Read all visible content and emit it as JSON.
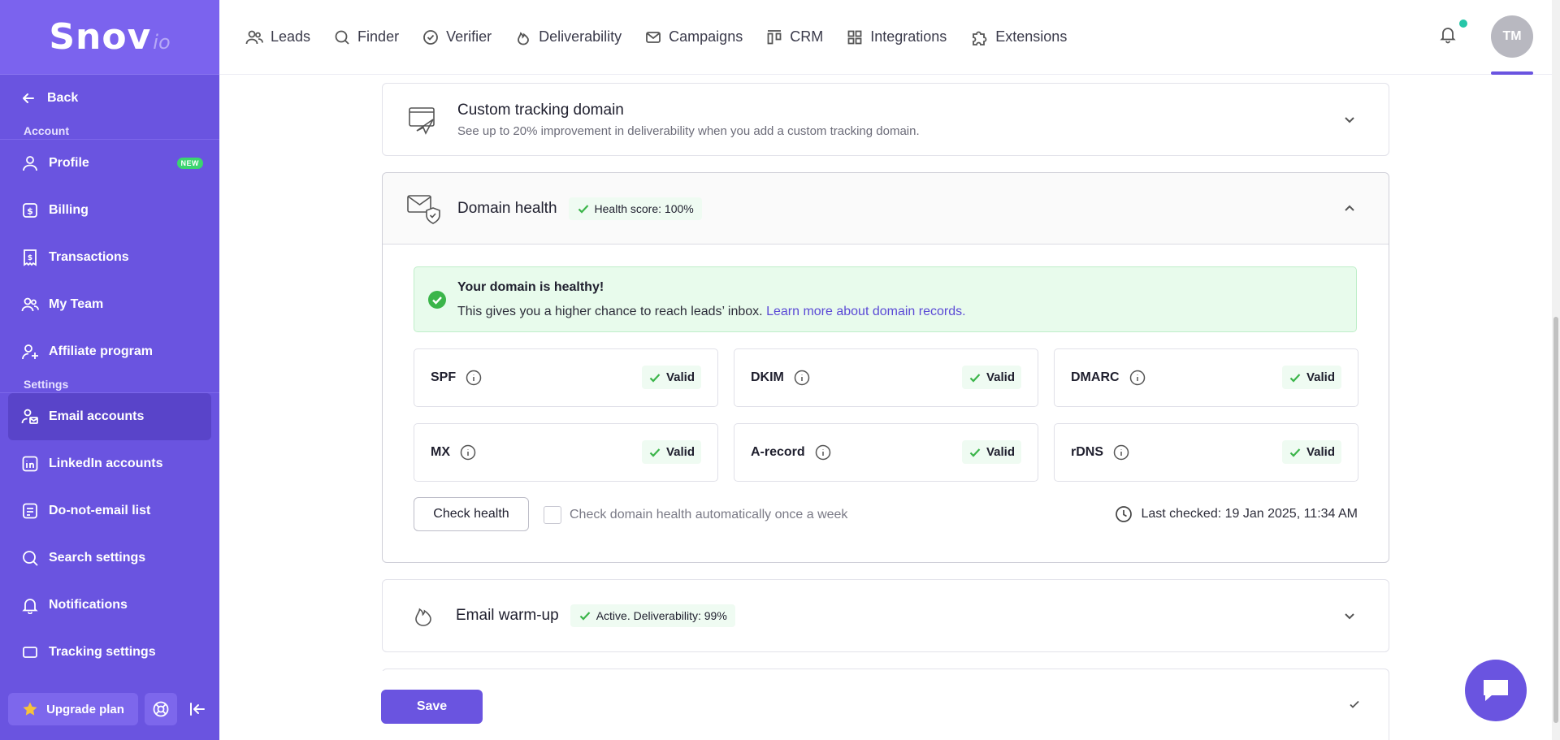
{
  "brand": {
    "name": "Snov",
    "suffix": "io"
  },
  "sidebar": {
    "back_label": "Back",
    "section_account": "Account",
    "section_settings": "Settings",
    "account_items": [
      {
        "label": "Profile",
        "icon": "user-icon",
        "badge": "NEW"
      },
      {
        "label": "Billing",
        "icon": "billing-icon"
      },
      {
        "label": "Transactions",
        "icon": "receipt-icon"
      },
      {
        "label": "My Team",
        "icon": "team-icon"
      },
      {
        "label": "Affiliate program",
        "icon": "user-plus-icon"
      }
    ],
    "settings_items": [
      {
        "label": "Email accounts",
        "icon": "email-account-icon",
        "active": true
      },
      {
        "label": "LinkedIn accounts",
        "icon": "linkedin-icon"
      },
      {
        "label": "Do-not-email list",
        "icon": "list-icon"
      },
      {
        "label": "Search settings",
        "icon": "search-icon"
      },
      {
        "label": "Notifications",
        "icon": "bell-icon"
      },
      {
        "label": "Tracking settings",
        "icon": "tracking-icon"
      }
    ],
    "upgrade_label": "Upgrade plan"
  },
  "topnav": {
    "items": [
      {
        "label": "Leads",
        "icon": "leads-icon"
      },
      {
        "label": "Finder",
        "icon": "search-icon"
      },
      {
        "label": "Verifier",
        "icon": "check-circle-icon"
      },
      {
        "label": "Deliverability",
        "icon": "flame-icon"
      },
      {
        "label": "Campaigns",
        "icon": "mail-icon"
      },
      {
        "label": "CRM",
        "icon": "crm-icon"
      },
      {
        "label": "Integrations",
        "icon": "grid-icon"
      },
      {
        "label": "Extensions",
        "icon": "puzzle-icon"
      }
    ],
    "avatar_initials": "TM"
  },
  "tracking_domain": {
    "title": "Custom tracking domain",
    "subtitle": "See up to 20% improvement in deliverability when you add a custom tracking domain."
  },
  "domain_health": {
    "title": "Domain health",
    "score_label": "Health score: 100%",
    "healthy_title": "Your domain is healthy!",
    "healthy_text": "This gives you a higher chance to reach leads’ inbox.",
    "learn_more": "Learn more about domain records.",
    "records": [
      {
        "name": "SPF",
        "status": "Valid"
      },
      {
        "name": "DKIM",
        "status": "Valid"
      },
      {
        "name": "DMARC",
        "status": "Valid"
      },
      {
        "name": "MX",
        "status": "Valid"
      },
      {
        "name": "A-record",
        "status": "Valid"
      },
      {
        "name": "rDNS",
        "status": "Valid"
      }
    ],
    "check_button": "Check health",
    "auto_check_label": "Check domain health automatically once a week",
    "last_checked": "Last checked: 19 Jan 2025, 11:34 AM"
  },
  "warmup": {
    "title": "Email warm-up",
    "status": "Active. Deliverability: 99%"
  },
  "save_label": "Save",
  "colors": {
    "accent": "#6a54e0",
    "success": "#3bb54a",
    "success_bg": "#e8fbec"
  }
}
